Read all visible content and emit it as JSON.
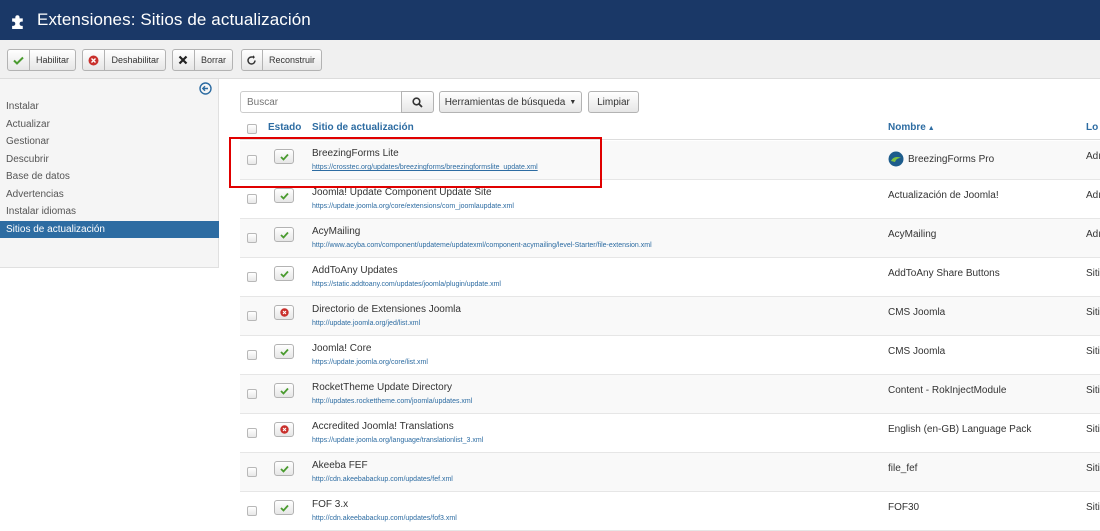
{
  "header": {
    "title": "Extensiones: Sitios de actualización",
    "icon": "puzzle-icon",
    "color": "#1a3867"
  },
  "toolbar": {
    "enable_label": "Habilitar",
    "disable_label": "Deshabilitar",
    "delete_label": "Borrar",
    "rebuild_label": "Reconstruir"
  },
  "sidebar": {
    "items": [
      {
        "label": "Instalar"
      },
      {
        "label": "Actualizar"
      },
      {
        "label": "Gestionar"
      },
      {
        "label": "Descubrir"
      },
      {
        "label": "Base de datos"
      },
      {
        "label": "Advertencias"
      },
      {
        "label": "Instalar idiomas"
      },
      {
        "label": "Sitios de actualización",
        "active": true
      }
    ],
    "active_color": "#2d6ca2"
  },
  "search": {
    "placeholder": "Buscar",
    "tools_label": "Herramientas de búsqueda",
    "clear_label": "Limpiar"
  },
  "table": {
    "headers": {
      "state": "Estado",
      "site": "Sitio de actualización",
      "name": "Nombre",
      "location": "Lo"
    },
    "rows": [
      {
        "enabled": true,
        "name": "BreezingForms Lite",
        "url": "https://crosstec.org/updates/breezingforms/breezingformslite_update.xml",
        "extension": "BreezingForms Pro",
        "location": "Adı"
      },
      {
        "enabled": true,
        "name": "Joomla! Update Component Update Site",
        "url": "https://update.joomla.org/core/extensions/com_joomlaupdate.xml",
        "extension": "Actualización de Joomla!",
        "location": "Adı"
      },
      {
        "enabled": true,
        "name": "AcyMailing",
        "url": "http://www.acyba.com/component/updateme/updatexml/component-acymailing/level-Starter/file-extension.xml",
        "extension": "AcyMailing",
        "location": "Adı"
      },
      {
        "enabled": true,
        "name": "AddToAny Updates",
        "url": "https://static.addtoany.com/updates/joomla/plugin/update.xml",
        "extension": "AddToAny Share Buttons",
        "location": "Siti"
      },
      {
        "enabled": false,
        "name": "Directorio de Extensiones Joomla",
        "url": "http://update.joomla.org/jed/list.xml",
        "extension": "CMS Joomla",
        "location": "Siti"
      },
      {
        "enabled": true,
        "name": "Joomla! Core",
        "url": "https://update.joomla.org/core/list.xml",
        "extension": "CMS Joomla",
        "location": "Siti"
      },
      {
        "enabled": true,
        "name": "RocketTheme Update Directory",
        "url": "http://updates.rockettheme.com/joomla/updates.xml",
        "extension": "Content - RokInjectModule",
        "location": "Siti"
      },
      {
        "enabled": false,
        "name": "Accredited Joomla! Translations",
        "url": "https://update.joomla.org/language/translationlist_3.xml",
        "extension": "English (en-GB) Language Pack",
        "location": "Siti"
      },
      {
        "enabled": true,
        "name": "Akeeba FEF",
        "url": "http://cdn.akeebabackup.com/updates/fef.xml",
        "extension": "file_fef",
        "location": "Siti"
      },
      {
        "enabled": true,
        "name": "FOF 3.x",
        "url": "http://cdn.akeebabackup.com/updates/fof3.xml",
        "extension": "FOF30",
        "location": "Siti"
      }
    ]
  },
  "colors": {
    "link": "#2d6ca2",
    "enabled": "#4a9b2f",
    "disabled": "#c9302c",
    "highlight": "#e00000"
  }
}
